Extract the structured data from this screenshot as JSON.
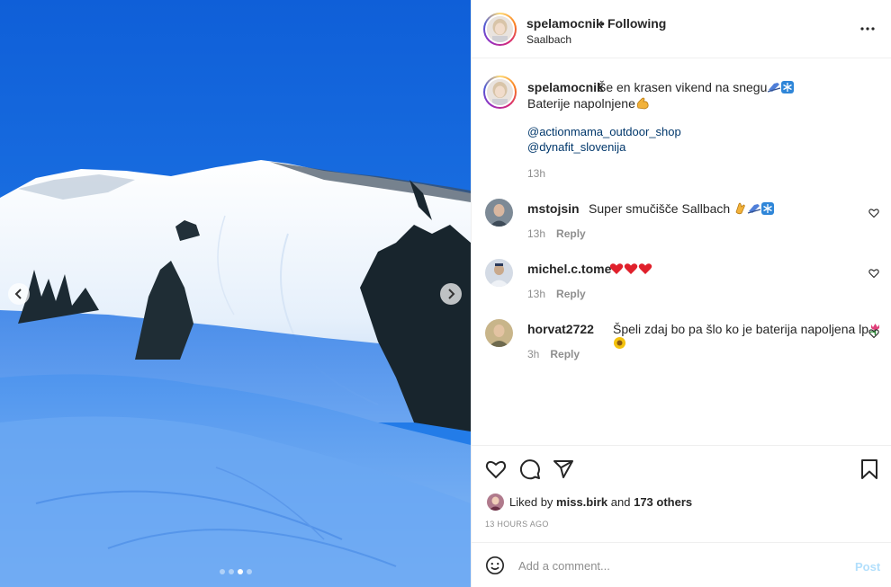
{
  "header": {
    "username": "spelamocnik",
    "bullet": "•",
    "follow_status": "Following",
    "location": "Saalbach"
  },
  "caption": {
    "username": "spelamocnik",
    "text": "Še en krasen vikend na snegu",
    "line2": "Baterije napolnjene",
    "mentions": [
      "@actionmama_outdoor_shop",
      "@dynafit_slovenija"
    ],
    "time": "13h"
  },
  "comments": [
    {
      "username": "mstojsin",
      "text": "Super smučišče Sallbach",
      "time": "13h",
      "reply": "Reply"
    },
    {
      "username": "michel.c.tome",
      "text": "",
      "time": "13h",
      "reply": "Reply"
    },
    {
      "username": "horvat2722",
      "text": "Špeli zdaj bo pa šlo ko je baterija napoljena lp",
      "time": "3h",
      "reply": "Reply"
    }
  ],
  "likes": {
    "prefix": "Liked by",
    "user": "miss.birk",
    "middle": "and",
    "others": "173 others"
  },
  "timestamp": "13 HOURS AGO",
  "add_comment": {
    "placeholder": "Add a comment...",
    "post_label": "Post"
  },
  "carousel": {
    "slides": 4,
    "active": 3
  },
  "icons": [
    "chevron-left-icon",
    "chevron-right-icon",
    "more-icon",
    "heart-icon",
    "comment-icon",
    "share-icon",
    "bookmark-icon",
    "smile-icon"
  ],
  "colors": {
    "link": "#00376b",
    "muted": "#8e8e8e",
    "post_disabled": "#b2dffc",
    "sky": "#1a6fe0"
  }
}
